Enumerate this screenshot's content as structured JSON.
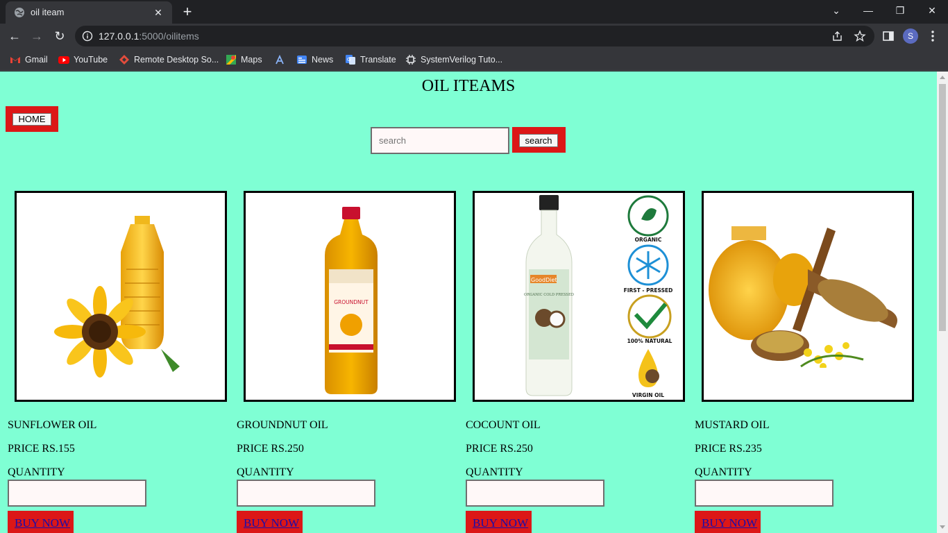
{
  "browser": {
    "tab_title": "oil iteam",
    "url_host": "127.0.0.1",
    "url_path": ":5000/oilitems",
    "profile_initial": "S",
    "bookmarks": [
      "Gmail",
      "YouTube",
      "Remote Desktop So...",
      "Maps",
      "",
      "News",
      "Translate",
      "SystemVerilog Tuto..."
    ]
  },
  "page": {
    "title": "OIL ITEAMS",
    "home_label": "HOME",
    "search_placeholder": "search",
    "search_label": "search",
    "background": "#7fffd4",
    "accent": "#dc1717"
  },
  "products": [
    {
      "name": "SUNFLOWER OIL",
      "price": "PRICE RS.155",
      "qty_label": "QUANTITY",
      "buy_label": "BUY NOW"
    },
    {
      "name": "GROUNDNUT OIL",
      "price": "PRICE RS.250",
      "qty_label": "QUANTITY",
      "buy_label": "BUY NOW",
      "bottle_label": "GROUNDNUT"
    },
    {
      "name": "COCOUNT OIL",
      "price": "PRICE RS.250",
      "qty_label": "QUANTITY",
      "buy_label": "BUY NOW",
      "brand": "GoodDiet",
      "bottle_text": "ORGANIC COLD PRESSED",
      "badges": [
        "ORGANIC",
        "FIRST - PRESSED",
        "100% NATURAL",
        "VIRGIN OIL"
      ]
    },
    {
      "name": "MUSTARD OIL",
      "price": "PRICE RS.235",
      "qty_label": "QUANTITY",
      "buy_label": "BUY NOW"
    }
  ]
}
